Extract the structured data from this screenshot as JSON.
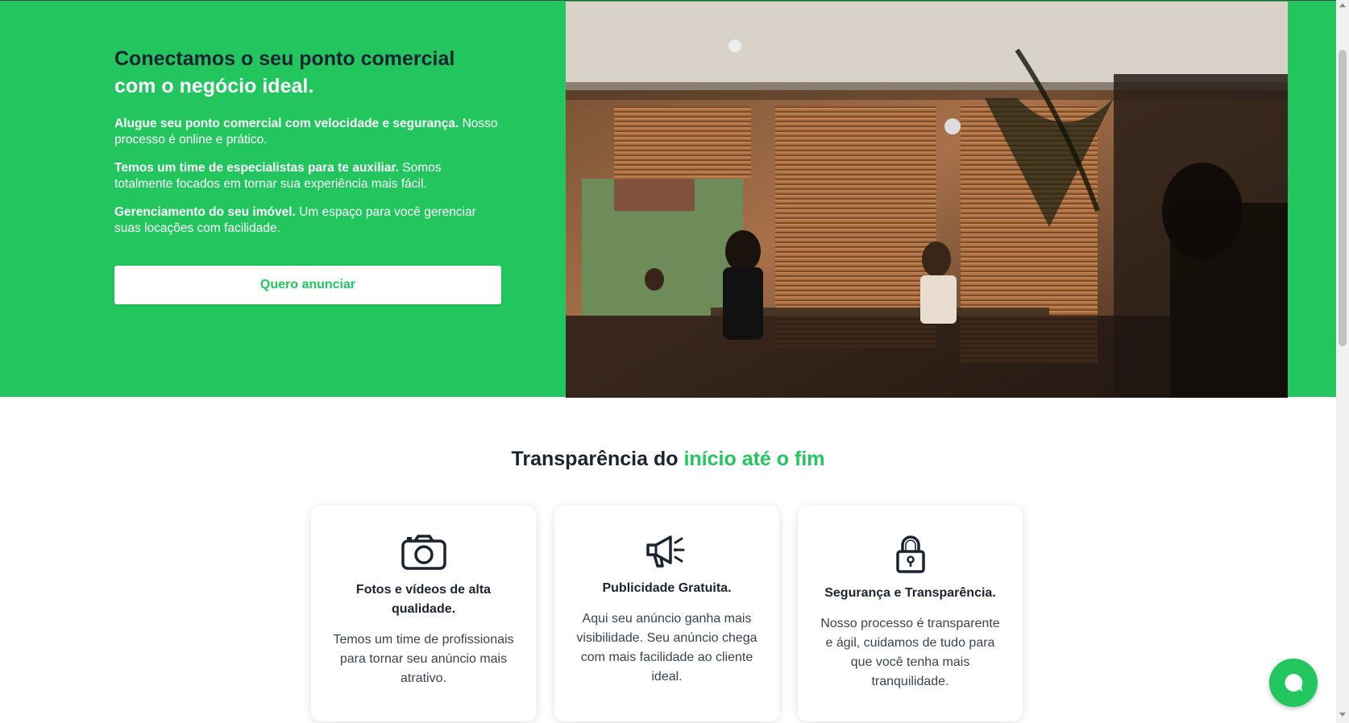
{
  "hero": {
    "title_dark": "Conectamos o seu ponto comercial",
    "title_highlight": "com o negócio ideal.",
    "paragraphs": [
      {
        "bold": "Alugue seu ponto comercial com velocidade e segurança.",
        "text": "Nosso processo é online e prático."
      },
      {
        "bold": "Temos um time de especialistas para te auxiliar.",
        "text": "Somos totalmente focados em tornar sua experiência mais fácil."
      },
      {
        "bold": "Gerenciamento do seu imóvel.",
        "text": "Um espaço para você gerenciar suas locações com facilidade."
      }
    ],
    "cta_label": "Quero anunciar"
  },
  "section": {
    "title_dark": "Transparência do",
    "title_highlight": "início até o fim"
  },
  "cards": [
    {
      "icon": "camera-icon",
      "title": "Fotos e vídeos de alta qualidade.",
      "text": "Temos um time de profissionais para tornar seu anúncio mais atrativo."
    },
    {
      "icon": "megaphone-icon",
      "title": "Publicidade Gratuita.",
      "text": "Aqui seu anúncio ganha mais visibilidade. Seu anúncio chega com mais facilidade ao cliente ideal."
    },
    {
      "icon": "padlock-icon",
      "title": "Segurança e Transparência.",
      "text": "Nosso processo é transparente e ágil, cuidamos de tudo para que você tenha mais tranquilidade."
    }
  ],
  "colors": {
    "brand_green": "#22c55e",
    "text_dark": "#1b2430"
  }
}
